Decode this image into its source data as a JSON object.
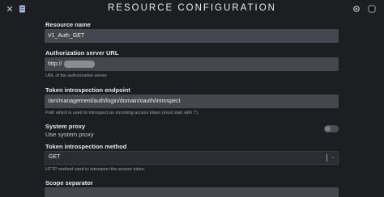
{
  "window": {
    "title": "RESOURCE CONFIGURATION"
  },
  "icons": {
    "close": "close-icon",
    "document": "document-icon",
    "settings": "gear-icon",
    "theme": "dark-mode-icon"
  },
  "form": {
    "resource_name": {
      "label": "Resource name",
      "value": "V1_Auth_GET"
    },
    "authorization_server_url": {
      "label": "Authorization server URL",
      "value": "http://",
      "help": "URL of the authorization server"
    },
    "token_introspection_endpoint": {
      "label": "Token introspection endpoint",
      "value": "/am/management/auth/login/domain/oauth/introspect",
      "help": "Path which is used to introspect an incoming access token (must start with '/')."
    },
    "system_proxy": {
      "label": "System proxy",
      "description": "Use system proxy",
      "enabled": false
    },
    "token_introspection_method": {
      "label": "Token introspection method",
      "value": "GET",
      "help": "HTTP method used to introspect the access token."
    },
    "scope_separator": {
      "label": "Scope separator"
    }
  }
}
